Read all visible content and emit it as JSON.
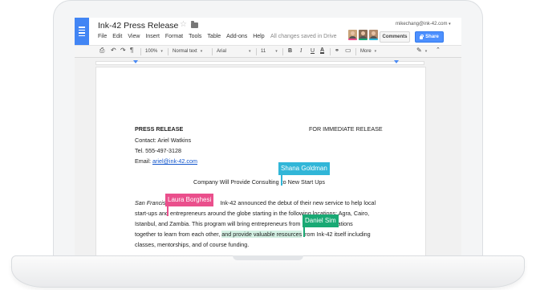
{
  "doc": {
    "title": "Ink-42 Press Release",
    "saved_status": "All changes saved in Drive",
    "user_email": "mikechang@ink-42.com"
  },
  "menu": [
    "File",
    "Edit",
    "View",
    "Insert",
    "Format",
    "Tools",
    "Table",
    "Add-ons",
    "Help"
  ],
  "header_buttons": {
    "comments": "Comments",
    "share": "Share"
  },
  "toolbar": {
    "zoom": "100%",
    "style": "Normal text",
    "font": "Arial",
    "size": "11",
    "bold": "B",
    "italic": "I",
    "underline": "U",
    "text_color": "A",
    "more": "More"
  },
  "content": {
    "press_release": "PRESS RELEASE",
    "immediate_release": "FOR IMMEDIATE RELEASE",
    "contact": "Contact: Ariel Watkins",
    "tel": "Tel. 555-497-3128",
    "email_label": "Email: ",
    "email_link": "ariel@ink-42.com",
    "subtitle_a": "Company Will Provide Consulting",
    "subtitle_b": "to New Start Ups",
    "p1_italic": "San Francis",
    "p1_rest": "Ink-42 announced the debut of their new service to help local",
    "p2_a": "start-ups and",
    "p2_b": "entrepreneurs around the globe starting in the following locations: Agra, Cairo,",
    "p3": "Istanbul, and Zambia. This program will bring entrepreneurs from",
    "p3_end": "locations",
    "p4_a": "together to learn from each other,",
    "p4_hl": "and provide valuable resources",
    "p4_b": "from Ink-42 itself including",
    "p5": "classes, mentorships, and of course funding."
  },
  "collaborators": [
    {
      "name": "Shana Goldman",
      "color": "#31b6d8"
    },
    {
      "name": "Laura Borghesi",
      "color": "#ea4f8c"
    },
    {
      "name": "Daniel Sim",
      "color": "#19a974"
    }
  ],
  "colors": {
    "accent_blue": "#4285f4",
    "share_blue": "#4d90fe"
  }
}
